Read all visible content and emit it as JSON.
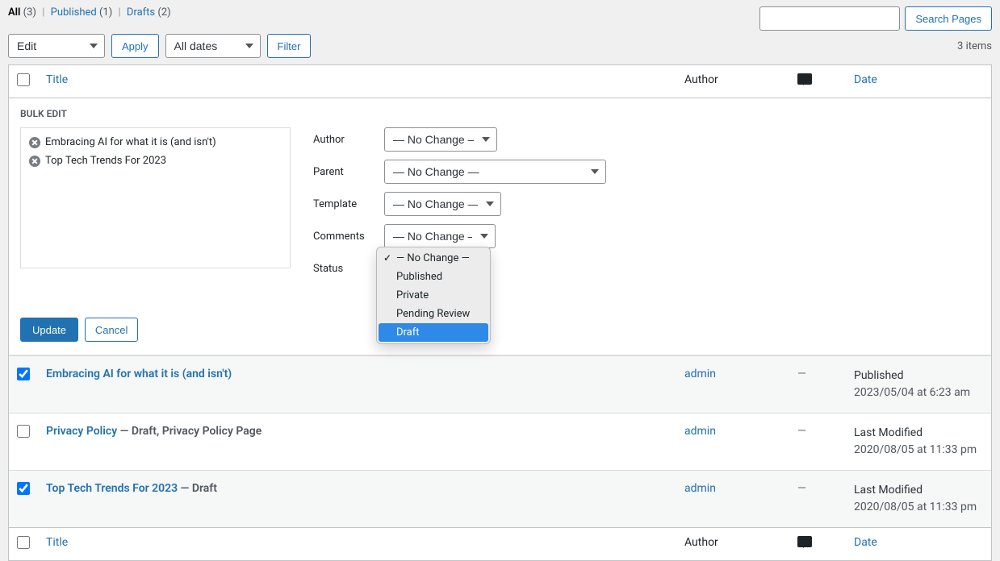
{
  "views": {
    "all_label": "All",
    "all_count": "(3)",
    "published_label": "Published",
    "published_count": "(1)",
    "drafts_label": "Drafts",
    "drafts_count": "(2)"
  },
  "search": {
    "button": "Search Pages"
  },
  "filters": {
    "bulk_action": "Edit",
    "apply": "Apply",
    "date": "All dates",
    "filter": "Filter",
    "items": "3 items"
  },
  "columns": {
    "title": "Title",
    "author": "Author",
    "date": "Date"
  },
  "bulk_edit": {
    "heading": "BULK EDIT",
    "items": [
      {
        "title": "Embracing AI for what it is (and isn't)"
      },
      {
        "title": "Top Tech Trends For 2023"
      }
    ],
    "labels": {
      "author": "Author",
      "parent": "Parent",
      "template": "Template",
      "comments": "Comments",
      "status": "Status"
    },
    "no_change": "— No Change —",
    "status_options": [
      {
        "label": "— No Change —",
        "checked": true,
        "highlighted": false
      },
      {
        "label": "Published",
        "checked": false,
        "highlighted": false
      },
      {
        "label": "Private",
        "checked": false,
        "highlighted": false
      },
      {
        "label": "Pending Review",
        "checked": false,
        "highlighted": false
      },
      {
        "label": "Draft",
        "checked": false,
        "highlighted": true
      }
    ],
    "update": "Update",
    "cancel": "Cancel"
  },
  "rows": [
    {
      "checked": true,
      "title": "Embracing AI for what it is (and isn't)",
      "state": "",
      "author": "admin",
      "comments": "—",
      "date_status": "Published",
      "date_value": "2023/05/04 at 6:23 am",
      "alt": true
    },
    {
      "checked": false,
      "title": "Privacy Policy",
      "state": " — Draft, Privacy Policy Page",
      "author": "admin",
      "comments": "—",
      "date_status": "Last Modified",
      "date_value": "2020/08/05 at 11:33 pm",
      "alt": false
    },
    {
      "checked": true,
      "title": "Top Tech Trends For 2023",
      "state": " — Draft",
      "author": "admin",
      "comments": "—",
      "date_status": "Last Modified",
      "date_value": "2020/08/05 at 11:33 pm",
      "alt": true
    }
  ]
}
